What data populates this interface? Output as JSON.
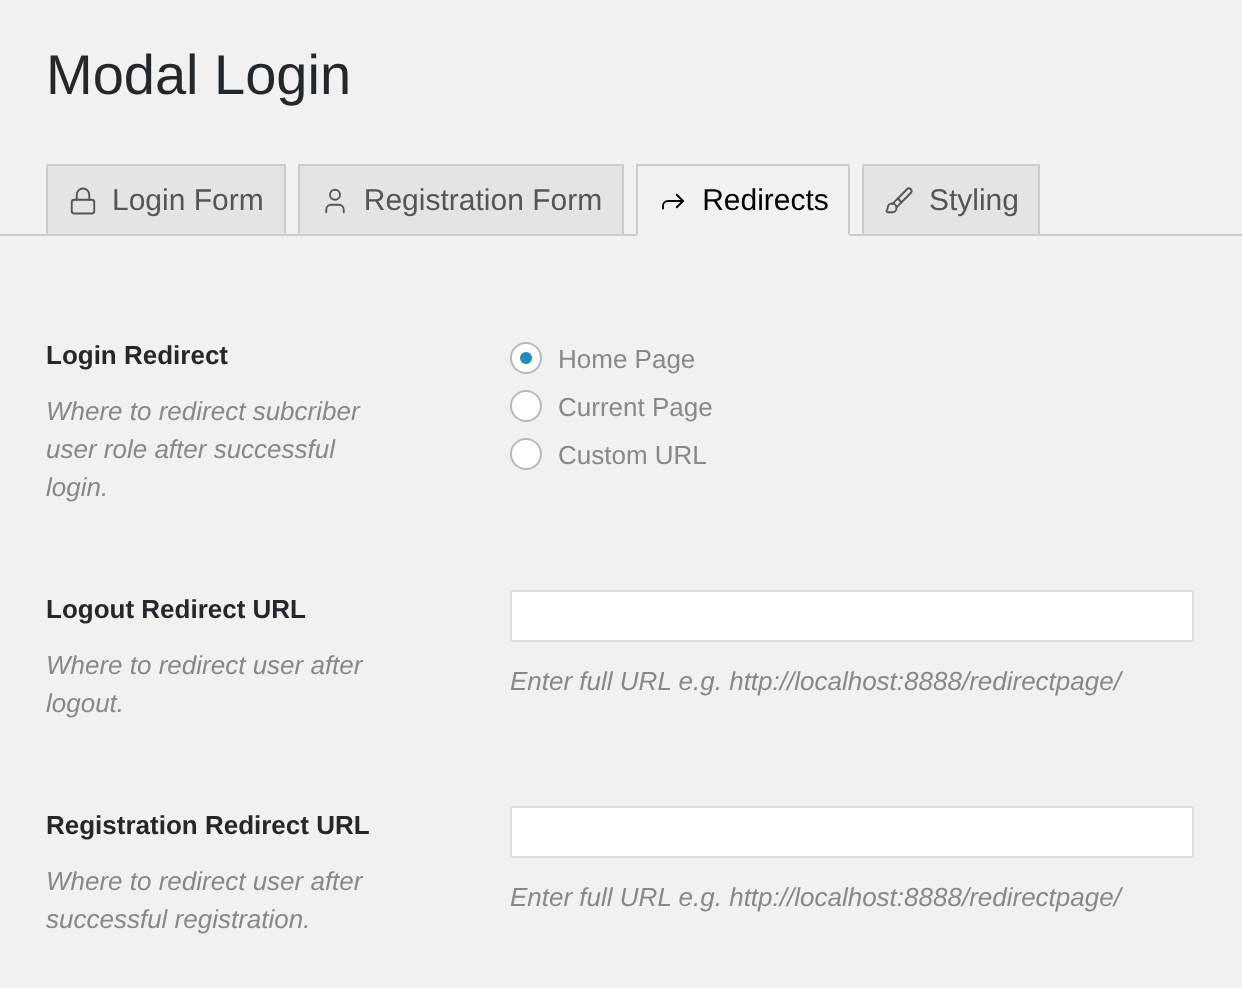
{
  "page": {
    "title": "Modal Login"
  },
  "tabs": [
    {
      "label": "Login Form",
      "selected": false
    },
    {
      "label": "Registration Form",
      "selected": false
    },
    {
      "label": "Redirects",
      "selected": true
    },
    {
      "label": "Styling",
      "selected": false
    }
  ],
  "settings": [
    {
      "kind": "radio",
      "label": "Login Redirect",
      "description": "Where to redirect subcriber user role after successful login.",
      "options": [
        {
          "label": "Home Page",
          "selected": true
        },
        {
          "label": "Current Page",
          "selected": false
        },
        {
          "label": "Custom URL",
          "selected": false
        }
      ]
    },
    {
      "kind": "url",
      "label": "Logout Redirect URL",
      "description": "Where to redirect user after logout.",
      "hint": "Enter full URL e.g. http://localhost:8888/redirectpage/"
    },
    {
      "kind": "url",
      "label": "Registration Redirect URL",
      "description": "Where to redirect user after successful registration.",
      "hint": "Enter full URL e.g. http://localhost:8888/redirectpage/"
    }
  ]
}
